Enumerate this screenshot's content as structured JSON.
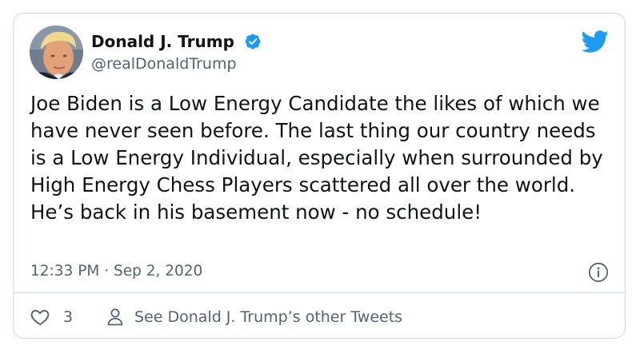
{
  "tweet": {
    "display_name": "Donald J. Trump",
    "handle": "@realDonaldTrump",
    "verified": true,
    "text": "Joe Biden is a Low Energy Candidate the likes of which we have never seen before. The last thing our country needs is a Low Energy Individual, especially when surrounded by High Energy Chess Players scattered all over the world. He’s back in his basement now - no schedule!",
    "timestamp": "12:33 PM · Sep 2, 2020",
    "like_count": "3",
    "see_more_label": "See Donald J. Trump’s other Tweets"
  },
  "icons": {
    "avatar": "profile-photo",
    "verified": "verified-badge-icon",
    "brand": "twitter-bird-icon",
    "info": "info-icon",
    "like": "heart-icon",
    "profile": "person-icon"
  },
  "colors": {
    "text": "#0f1419",
    "secondary_text": "#536471",
    "border": "#cfd9de",
    "twitter_blue": "#1d9bf0",
    "verified_blue": "#1d9bf0"
  }
}
